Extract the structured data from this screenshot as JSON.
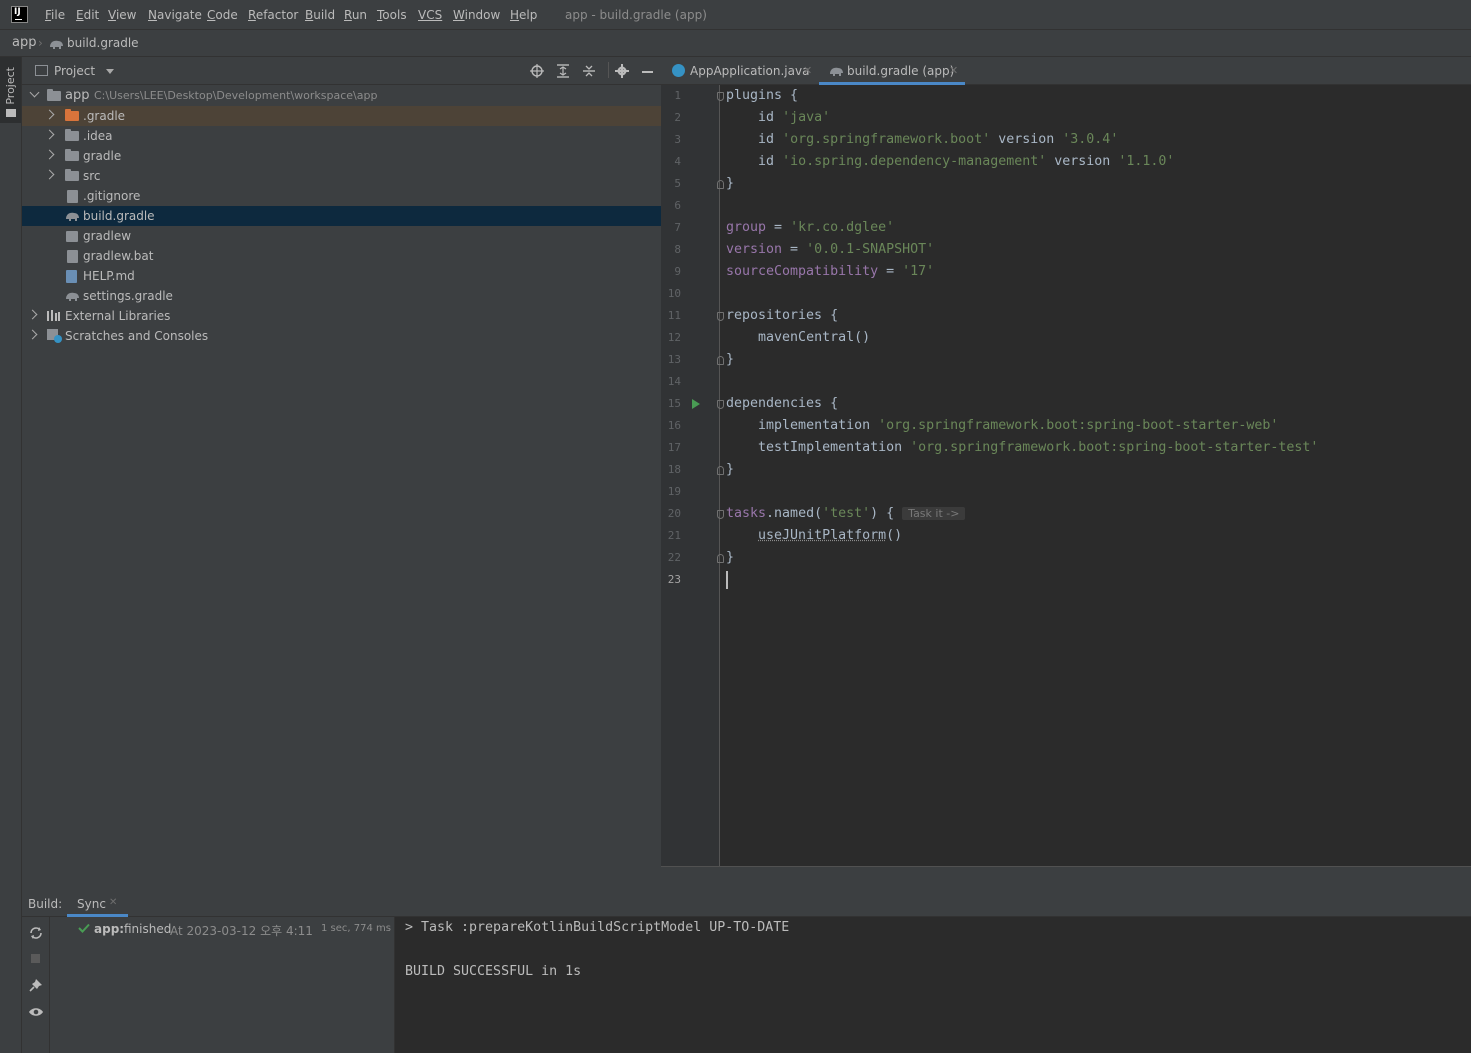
{
  "menubar": {
    "items": [
      {
        "label": "File",
        "mnemonic": "F",
        "rest": "ile"
      },
      {
        "label": "Edit",
        "mnemonic": "E",
        "rest": "dit"
      },
      {
        "label": "View",
        "mnemonic": "V",
        "rest": "iew"
      },
      {
        "label": "Navigate",
        "mnemonic": "N",
        "rest": "avigate"
      },
      {
        "label": "Code",
        "mnemonic": "C",
        "rest": "ode"
      },
      {
        "label": "Refactor",
        "mnemonic": "R",
        "rest": "efactor"
      },
      {
        "label": "Build",
        "mnemonic": "B",
        "rest": "uild"
      },
      {
        "label": "Run",
        "mnemonic": "R",
        "rest": "un"
      },
      {
        "label": "Tools",
        "mnemonic": "T",
        "rest": "ools"
      },
      {
        "label": "VCS",
        "mnemonic": "",
        "rest": "VCS"
      },
      {
        "label": "Window",
        "mnemonic": "W",
        "rest": "indow"
      },
      {
        "label": "Help",
        "mnemonic": "H",
        "rest": "elp"
      }
    ],
    "window_title": "app - build.gradle (app)"
  },
  "navbar": {
    "root": "app",
    "file": "build.gradle"
  },
  "left_strip": {
    "project_tab": "Project"
  },
  "project_panel": {
    "title": "Project",
    "root_name": "app",
    "root_path": "C:\\Users\\LEE\\Desktop\\Development\\workspace\\app",
    "items": [
      {
        "name": ".gradle"
      },
      {
        "name": ".idea"
      },
      {
        "name": "gradle"
      },
      {
        "name": "src"
      },
      {
        "name": ".gitignore"
      },
      {
        "name": "build.gradle"
      },
      {
        "name": "gradlew"
      },
      {
        "name": "gradlew.bat"
      },
      {
        "name": "HELP.md"
      },
      {
        "name": "settings.gradle"
      }
    ],
    "external_libraries": "External Libraries",
    "scratches": "Scratches and Consoles"
  },
  "editor_tabs": [
    {
      "label": "AppApplication.java"
    },
    {
      "label": "build.gradle (app)"
    }
  ],
  "code": {
    "line_numbers": [
      "1",
      "2",
      "3",
      "4",
      "5",
      "6",
      "7",
      "8",
      "9",
      "10",
      "11",
      "12",
      "13",
      "14",
      "15",
      "16",
      "17",
      "18",
      "19",
      "20",
      "21",
      "22",
      "23"
    ],
    "plugins": "plugins",
    "id_kw": "id",
    "java": "'java'",
    "boot_plugin": "'org.springframework.boot'",
    "version_kw": "version",
    "boot_version": "'3.0.4'",
    "dep_mgmt_plugin": "'io.spring.dependency-management'",
    "dep_mgmt_version": "'1.1.0'",
    "group_prop": "group",
    "group_val": "'kr.co.dglee'",
    "version_prop": "version",
    "version_val": "'0.0.1-SNAPSHOT'",
    "source_prop": "sourceCompatibility",
    "source_val": "'17'",
    "repositories": "repositories",
    "maven_central": "mavenCentral()",
    "dependencies": "dependencies",
    "impl": "implementation",
    "impl_val": "'org.springframework.boot:spring-boot-starter-web'",
    "test_impl": "testImplementation",
    "test_impl_val": "'org.springframework.boot:spring-boot-starter-test'",
    "tasks": "tasks",
    "named": "named",
    "test_str": "'test'",
    "task_hint": "Task it ->",
    "junit": "useJUnitPlatform",
    "junit_parens": "()"
  },
  "build_panel": {
    "label": "Build:",
    "tab": "Sync",
    "result_name": "app:",
    "result_status": "finished",
    "result_time": "At 2023-03-12 오후 4:11",
    "result_duration": "1 sec, 774 ms",
    "console_line1": "> Task :prepareKotlinBuildScriptModel UP-TO-DATE",
    "console_line2": "BUILD SUCCESSFUL in 1s"
  }
}
